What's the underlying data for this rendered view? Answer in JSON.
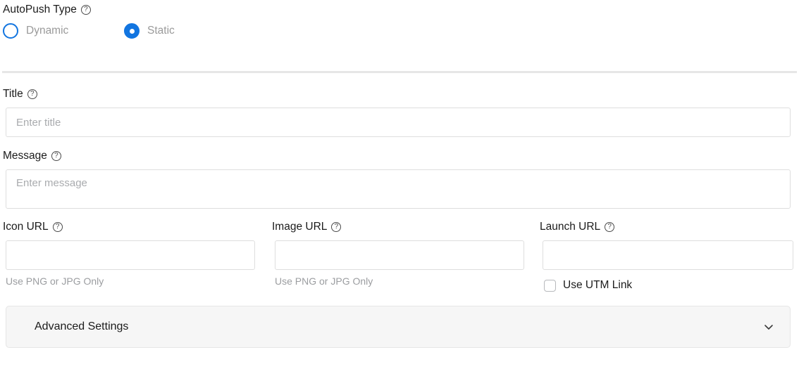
{
  "form": {
    "autopush": {
      "label": "AutoPush Type",
      "help_icon": "help-circle-icon",
      "options": [
        {
          "label": "Dynamic",
          "selected": false
        },
        {
          "label": "Static",
          "selected": true
        }
      ]
    },
    "title": {
      "label": "Title",
      "help_icon": "help-circle-icon",
      "value": "",
      "placeholder": "Enter title"
    },
    "message": {
      "label": "Message",
      "help_icon": "help-circle-icon",
      "value": "",
      "placeholder": "Enter message"
    },
    "icon_url": {
      "label": "Icon URL",
      "help_icon": "help-circle-icon",
      "value": "",
      "placeholder": "",
      "helper": "Use PNG or JPG Only"
    },
    "image_url": {
      "label": "Image URL",
      "help_icon": "help-circle-icon",
      "value": "",
      "placeholder": "",
      "helper": "Use PNG or JPG Only"
    },
    "launch_url": {
      "label": "Launch URL",
      "help_icon": "help-circle-icon",
      "value": "",
      "placeholder": "",
      "utm_checkbox_label": "Use UTM Link",
      "utm_checked": false
    },
    "advanced": {
      "label": "Advanced Settings",
      "chevron_icon": "chevron-down-icon",
      "expanded": false
    }
  },
  "colors": {
    "accent_blue": "#1275e0",
    "label_text": "#1b1b1b",
    "muted_text": "#9a9a9a",
    "helper_text": "#9b9da0",
    "border": "#dedede",
    "divider": "#e6e6e6",
    "panel_bg": "#f6f6f6"
  }
}
